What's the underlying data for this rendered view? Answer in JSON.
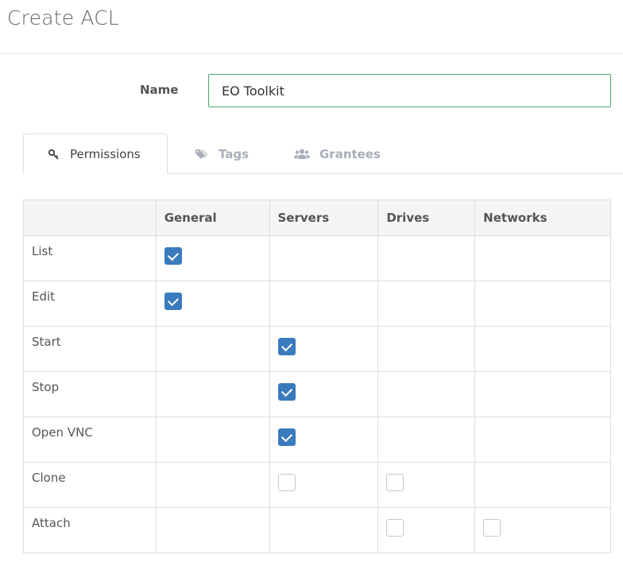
{
  "page": {
    "title": "Create ACL"
  },
  "form": {
    "name_label": "Name",
    "name_value": "EO Toolkit"
  },
  "tabs": [
    {
      "label": "Permissions",
      "icon": "key-icon",
      "active": true
    },
    {
      "label": "Tags",
      "icon": "tags-icon",
      "active": false
    },
    {
      "label": "Grantees",
      "icon": "users-icon",
      "active": false
    }
  ],
  "table": {
    "headers": [
      "",
      "General",
      "Servers",
      "Drives",
      "Networks"
    ],
    "rows": [
      {
        "label": "List",
        "cells": [
          true,
          null,
          null,
          null
        ]
      },
      {
        "label": "Edit",
        "cells": [
          true,
          null,
          null,
          null
        ]
      },
      {
        "label": "Start",
        "cells": [
          null,
          true,
          null,
          null
        ]
      },
      {
        "label": "Stop",
        "cells": [
          null,
          true,
          null,
          null
        ]
      },
      {
        "label": "Open VNC",
        "cells": [
          null,
          true,
          null,
          null
        ]
      },
      {
        "label": "Clone",
        "cells": [
          null,
          false,
          false,
          null
        ]
      },
      {
        "label": "Attach",
        "cells": [
          null,
          null,
          false,
          false
        ]
      }
    ]
  },
  "colors": {
    "accent": "#3a7bbd",
    "input_border": "#4aa96c"
  }
}
